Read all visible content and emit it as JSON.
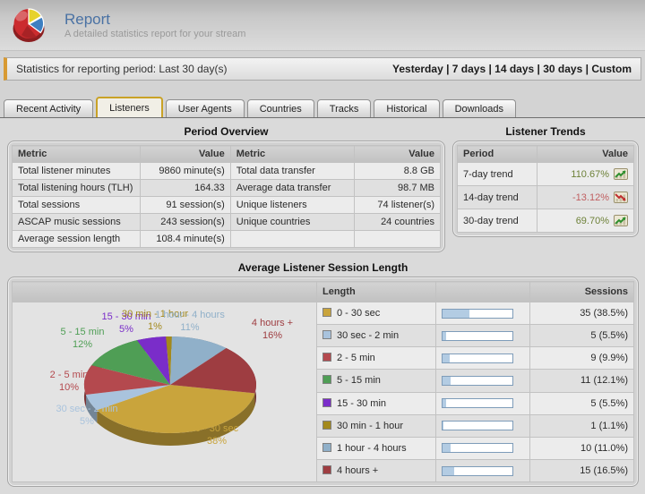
{
  "header": {
    "title": "Report",
    "subtitle": "A detailed statistics report for your stream",
    "logo": "pie-chart-logo"
  },
  "stats_bar": {
    "label": "Statistics for reporting period: Last 30 day(s)",
    "links": [
      "Yesterday",
      "7 days",
      "14 days",
      "30 days",
      "Custom"
    ],
    "separator": " | ",
    "accent_color": "#d89a33"
  },
  "tabs": {
    "items": [
      "Recent Activity",
      "Listeners",
      "User Agents",
      "Countries",
      "Tracks",
      "Historical",
      "Downloads"
    ],
    "active": "Listeners",
    "active_border_color": "#c9a227"
  },
  "period_overview": {
    "title": "Period Overview",
    "columns": [
      "Metric",
      "Value",
      "Metric",
      "Value"
    ],
    "rows": [
      [
        "Total listener minutes",
        "9860 minute(s)",
        "Total data transfer",
        "8.8 GB"
      ],
      [
        "Total listening hours (TLH)",
        "164.33",
        "Average data transfer",
        "98.7 MB"
      ],
      [
        "Total sessions",
        "91 session(s)",
        "Unique listeners",
        "74 listener(s)"
      ],
      [
        "ASCAP music sessions",
        "243 session(s)",
        "Unique countries",
        "24 countries"
      ],
      [
        "Average session length",
        "108.4 minute(s)",
        "",
        ""
      ]
    ]
  },
  "listener_trends": {
    "title": "Listener Trends",
    "columns": [
      "Period",
      "Value"
    ],
    "rows": [
      {
        "period": "7-day trend",
        "value": "110.67%",
        "direction": "up"
      },
      {
        "period": "14-day trend",
        "value": "-13.12%",
        "direction": "down"
      },
      {
        "period": "30-day trend",
        "value": "69.70%",
        "direction": "up"
      }
    ],
    "up_color": "#6d8138",
    "down_color": "#c05e60"
  },
  "session_length": {
    "title": "Average Listener Session Length",
    "columns": {
      "length": "Length",
      "sessions": "Sessions"
    },
    "rows": [
      {
        "label": "0 - 30 sec",
        "color": "#c9a43c",
        "sessions": 35,
        "pct": 38.5,
        "display": "35 (38.5%)"
      },
      {
        "label": "30 sec - 2 min",
        "color": "#a9c3dd",
        "sessions": 5,
        "pct": 5.5,
        "display": "5 (5.5%)"
      },
      {
        "label": "2 - 5 min",
        "color": "#b4494e",
        "sessions": 9,
        "pct": 9.9,
        "display": "9 (9.9%)"
      },
      {
        "label": "5 - 15 min",
        "color": "#4f9e55",
        "sessions": 11,
        "pct": 12.1,
        "display": "11 (12.1%)"
      },
      {
        "label": "15 - 30 min",
        "color": "#7a2dc9",
        "sessions": 5,
        "pct": 5.5,
        "display": "5 (5.5%)"
      },
      {
        "label": "30 min - 1 hour",
        "color": "#a3891c",
        "sessions": 1,
        "pct": 1.1,
        "display": "1 (1.1%)"
      },
      {
        "label": "1 hour - 4 hours",
        "color": "#90b0c9",
        "sessions": 10,
        "pct": 11.0,
        "display": "10 (11.0%)"
      },
      {
        "label": "4 hours +",
        "color": "#9e3d41",
        "sessions": 15,
        "pct": 16.5,
        "display": "15 (16.5%)"
      }
    ]
  },
  "chart_data": {
    "type": "pie",
    "style": "3d",
    "title": "Average Listener Session Length",
    "labels": [
      "0 - 30 sec",
      "30 sec - 2 min",
      "2 - 5 min",
      "5 - 15 min",
      "15 - 30 min",
      "30 min - 1 hour",
      "1 hour - 4 hours",
      "4 hours +"
    ],
    "values": [
      35,
      5,
      9,
      11,
      5,
      1,
      10,
      15
    ],
    "percent_labels": [
      "38%",
      "5%",
      "10%",
      "12%",
      "5%",
      "1%",
      "11%",
      "16%"
    ],
    "colors": [
      "#c9a43c",
      "#a9c3dd",
      "#b4494e",
      "#4f9e55",
      "#7a2dc9",
      "#a3891c",
      "#90b0c9",
      "#9e3d41"
    ],
    "value_displays": [
      "35 (38.5%)",
      "5 (5.5%)",
      "9 (9.9%)",
      "11 (12.1%)",
      "5 (5.5%)",
      "1 (1.1%)",
      "10 (11.0%)",
      "15 (16.5%)"
    ],
    "legend_position": "right"
  }
}
